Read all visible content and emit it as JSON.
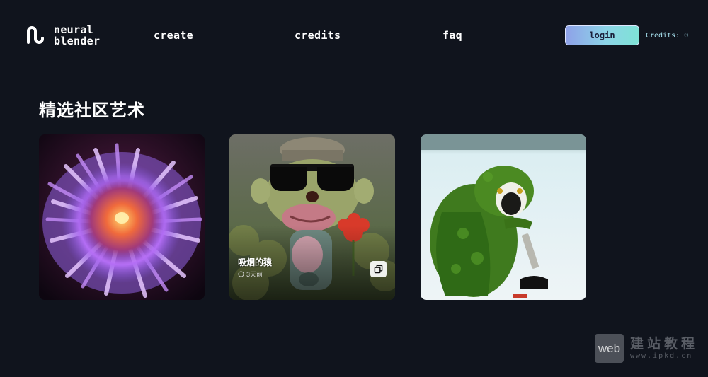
{
  "header": {
    "brand": {
      "line1": "neural",
      "line2": "blender"
    },
    "nav": {
      "create": "create",
      "credits": "credits",
      "faq": "faq"
    },
    "login_label": "login",
    "credits_label": "Credits: 0"
  },
  "section": {
    "title": "精选社区艺术",
    "cards": [
      {
        "subject": "sea anemone"
      },
      {
        "subject": "ape with sunglasses",
        "title": "吸烟的猿",
        "time": "3天前"
      },
      {
        "subject": "green monkey"
      }
    ]
  },
  "watermark": {
    "box": "web",
    "title": "建站教程",
    "url": "www.ipkd.cn"
  },
  "colors": {
    "background": "#10141d",
    "login_gradient_start": "#8fa1e8",
    "login_gradient_end": "#7fe3d6",
    "credits_text": "#a9e4f2"
  },
  "icons": {
    "brand": "neural-blender-logo-icon",
    "clock": "clock-icon",
    "copy": "copy-icon"
  }
}
